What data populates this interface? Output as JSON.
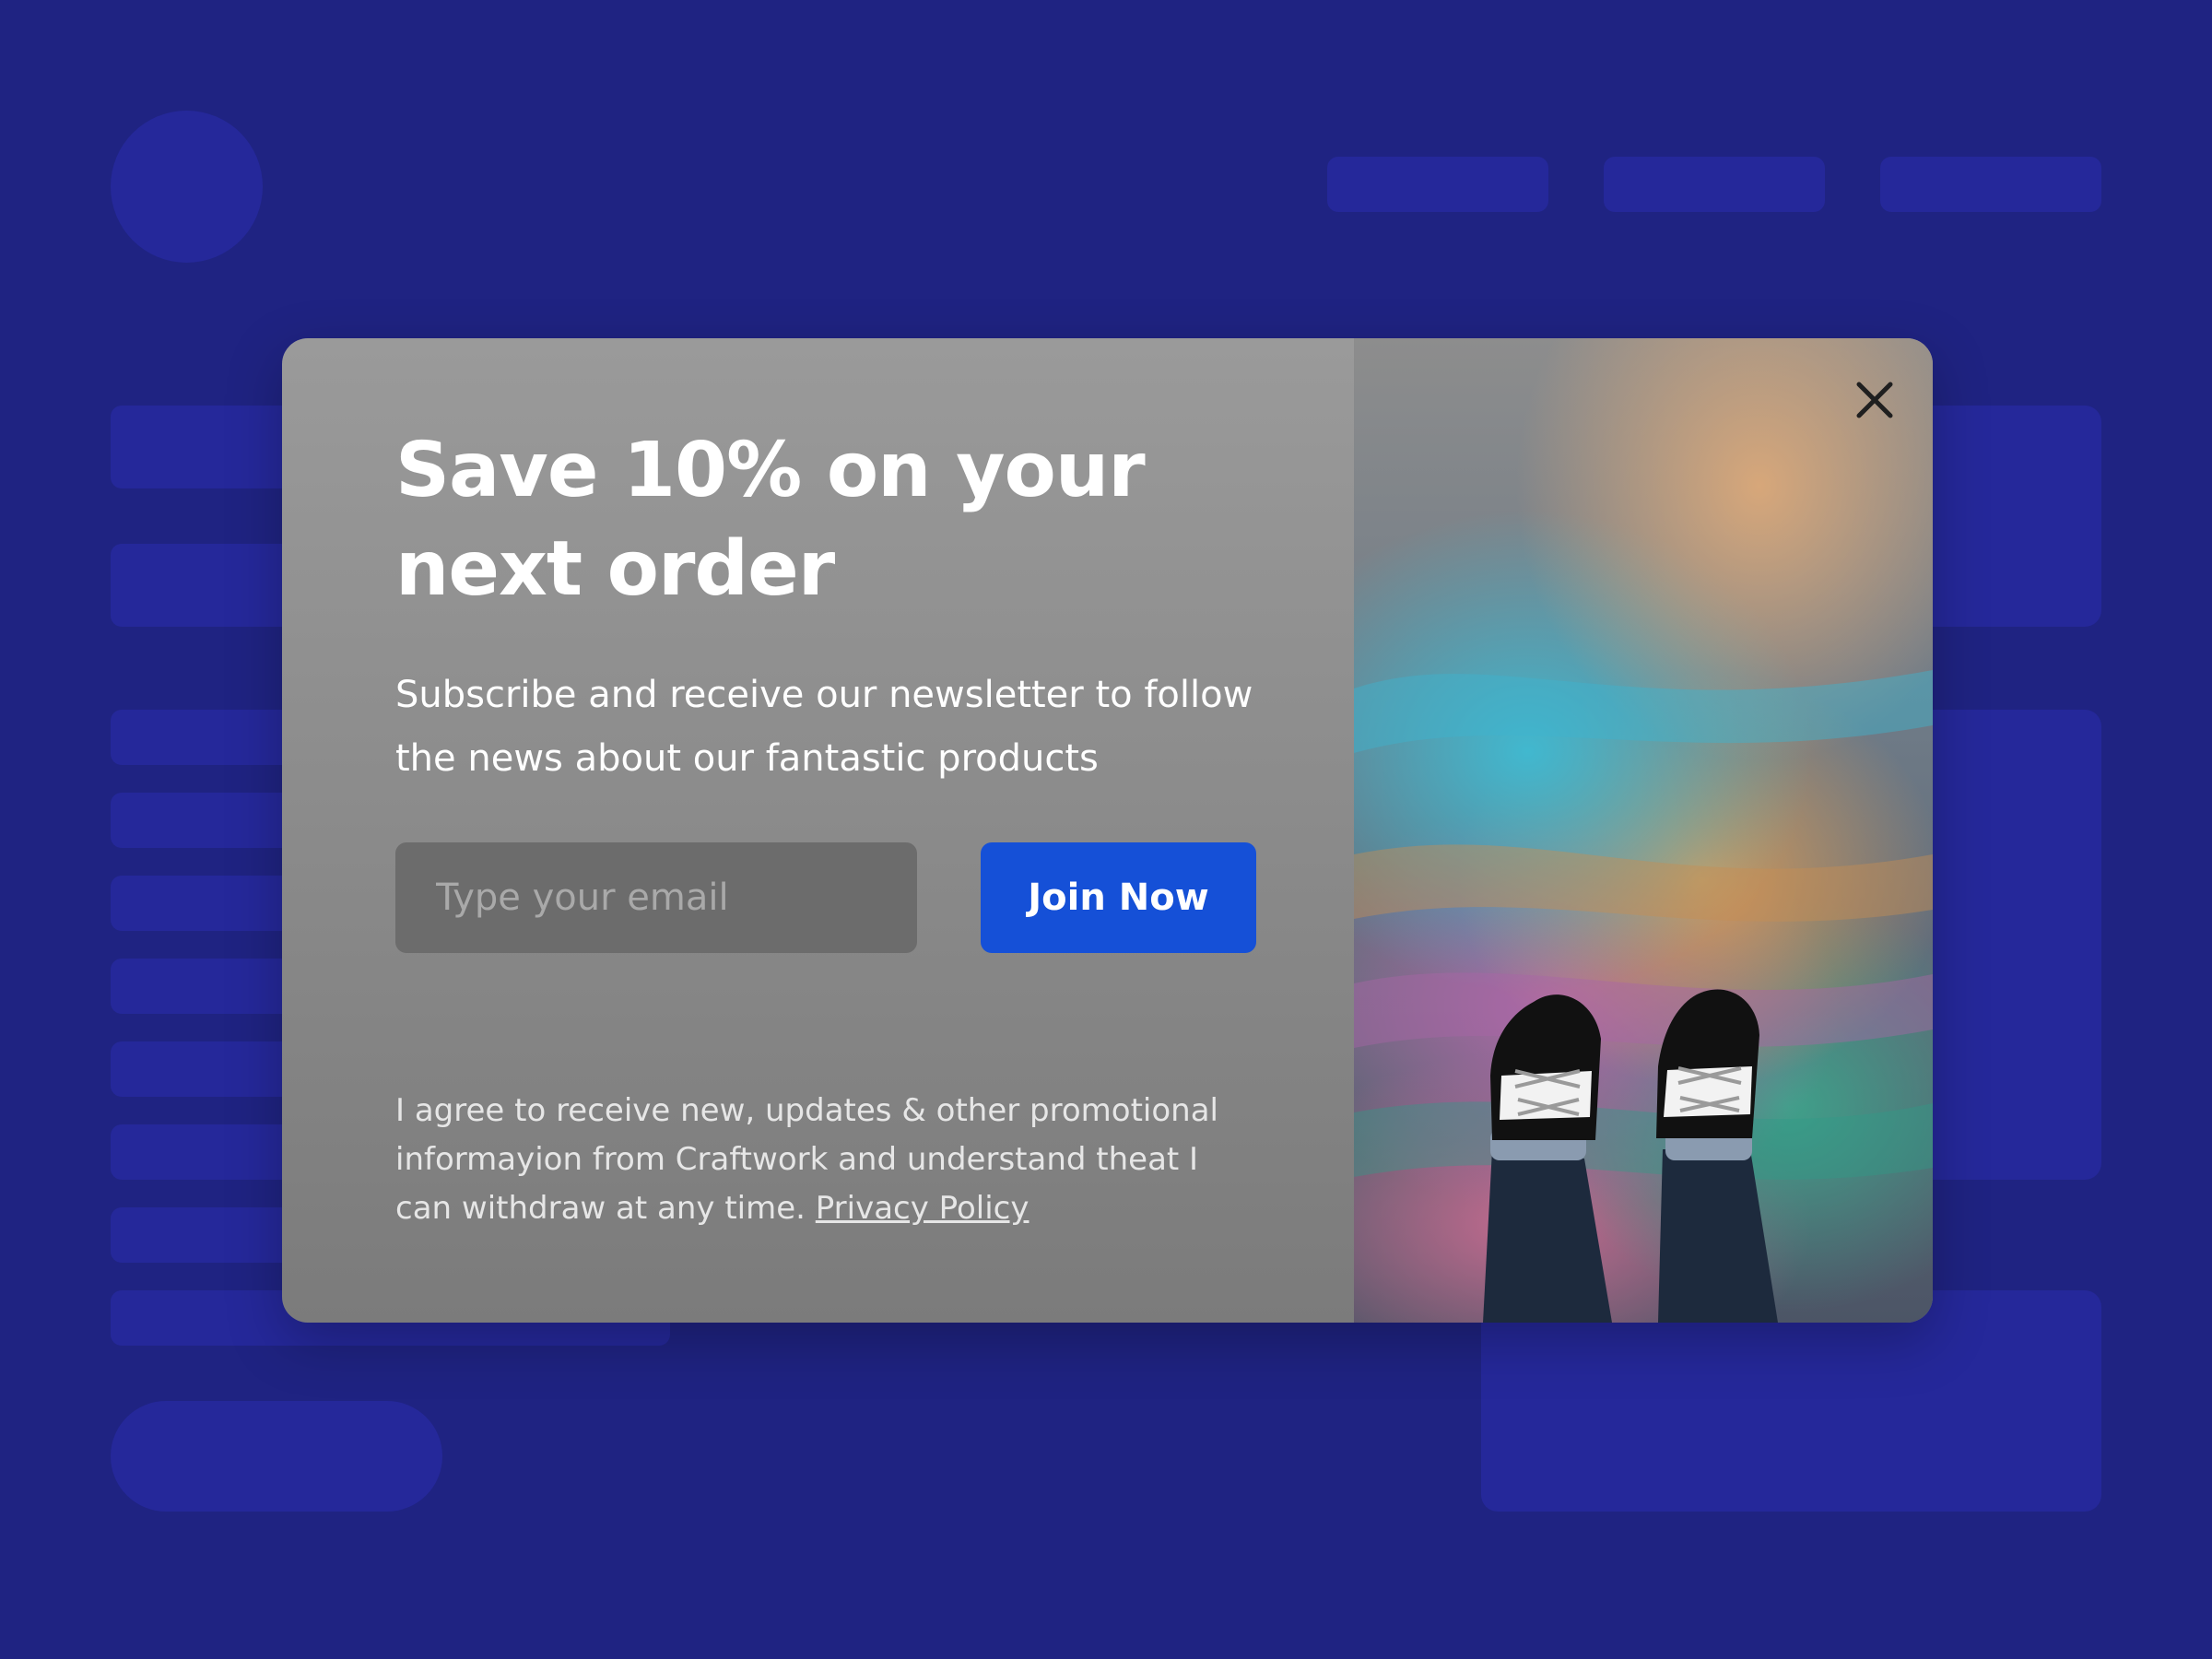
{
  "popup": {
    "headline": "Save 10% on your\nnext order",
    "subtitle": "Subscribe and receive our newsletter to follow the news about our fantastic products",
    "email": {
      "placeholder": "Type your email",
      "value": ""
    },
    "join_button_label": "Join Now",
    "consent_text": "I agree to receive new, updates & other promotional informayion from Craftwork and understand theat I can withdraw at any time.",
    "privacy_link_label": "Privacy Policy"
  },
  "icons": {
    "close": "close-icon"
  },
  "colors": {
    "page_background": "#1f2382",
    "placeholder_blocks": "#25289a",
    "modal_panel": "#8c8c8c",
    "input_background": "#6c6c6c",
    "primary_button": "#1550d7",
    "text": "#ffffff"
  }
}
